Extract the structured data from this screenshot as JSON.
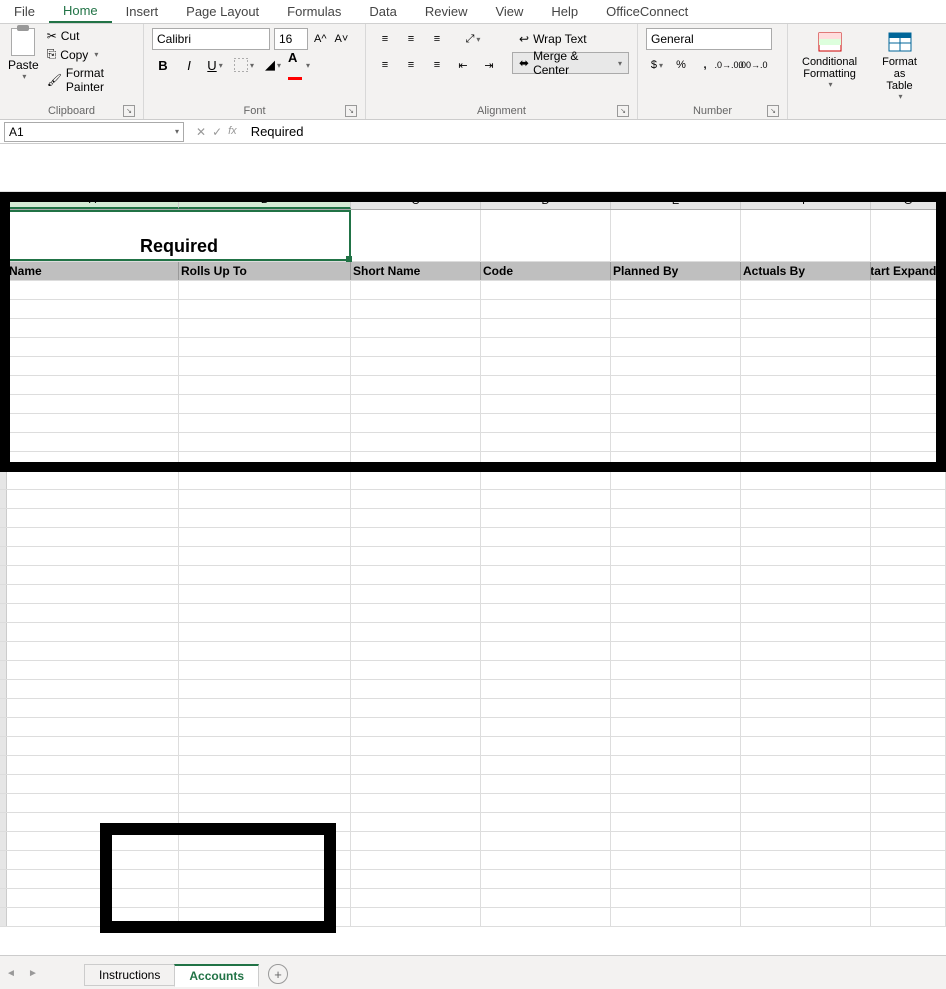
{
  "ribbonTabs": [
    "File",
    "Home",
    "Insert",
    "Page Layout",
    "Formulas",
    "Data",
    "Review",
    "View",
    "Help",
    "OfficeConnect"
  ],
  "activeTab": "Home",
  "clipboard": {
    "paste": "Paste",
    "cut": "Cut",
    "copy": "Copy",
    "formatPainter": "Format Painter",
    "label": "Clipboard"
  },
  "font": {
    "name": "Calibri",
    "size": "16",
    "label": "Font"
  },
  "alignment": {
    "wrap": "Wrap Text",
    "merge": "Merge & Center",
    "label": "Alignment"
  },
  "number": {
    "format": "General",
    "label": "Number"
  },
  "styles": {
    "condFmt": "Conditional\nFormatting",
    "tableFmt": "Format as\nTable"
  },
  "nameBox": "A1",
  "formulaValue": "Required",
  "columns": [
    "A",
    "B",
    "C",
    "D",
    "E",
    "F",
    "G"
  ],
  "requiredLabel": "Required",
  "tableHeaders": [
    "Name",
    "Rolls Up To",
    "Short Name",
    "Code",
    "Planned By",
    "Actuals By",
    "Start Expande"
  ],
  "sheetTabs": {
    "tab1": "Instructions",
    "tab2": "Accounts"
  }
}
